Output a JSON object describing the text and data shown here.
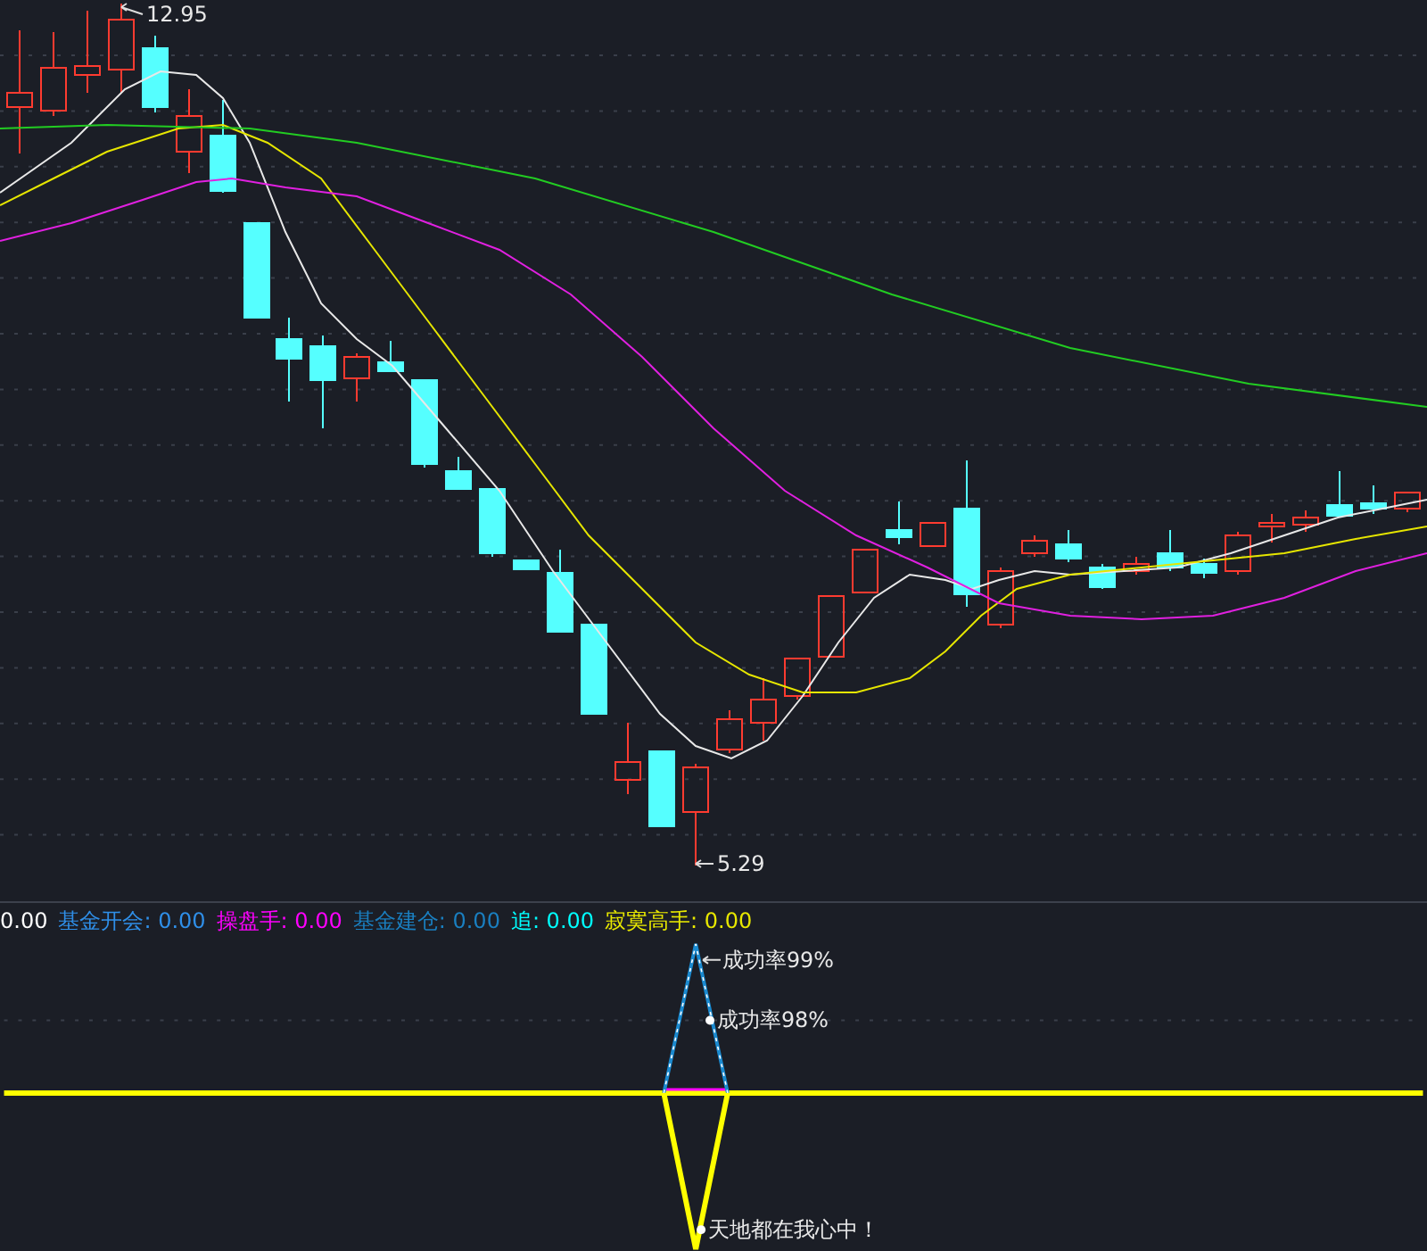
{
  "main_chart": {
    "high_label": "12.95",
    "low_label": "5.29"
  },
  "indicator_legend": [
    {
      "value": "0.00",
      "color": "#ffffff"
    },
    {
      "label": "基金开会:",
      "value": "0.00",
      "color": "#2f8fe8"
    },
    {
      "label": "操盘手:",
      "value": "0.00",
      "color": "#ff00ff"
    },
    {
      "label": "基金建仓:",
      "value": "0.00",
      "color": "#1a7fc0"
    },
    {
      "label": "追:",
      "value": "0.00",
      "color": "#00ffff"
    },
    {
      "label": "寂寞高手:",
      "value": "0.00",
      "color": "#e8e800"
    }
  ],
  "signal_panel": {
    "annotations": [
      "成功率99%",
      "成功率98%",
      "天地都在我心中！"
    ]
  }
}
